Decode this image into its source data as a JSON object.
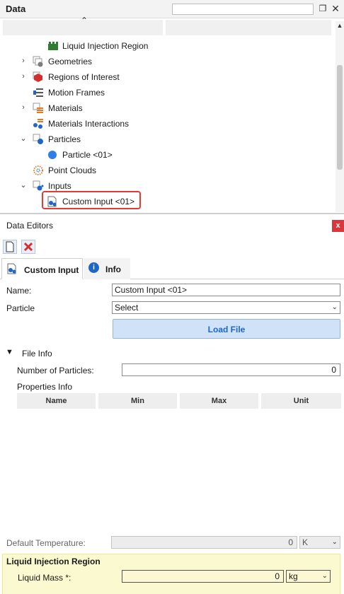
{
  "data_panel": {
    "title": "Data",
    "search_value": "",
    "tree": [
      {
        "label": "Liquid Injection Region",
        "icon": "liquid-injection-region-icon",
        "expander": "",
        "level": 2
      },
      {
        "label": "Geometries",
        "icon": "geometries-folder-icon",
        "expander": "›",
        "level": 1
      },
      {
        "label": "Regions of Interest",
        "icon": "regions-of-interest-folder-icon",
        "expander": "›",
        "level": 1
      },
      {
        "label": "Motion Frames",
        "icon": "motion-frames-icon",
        "expander": "",
        "level": 1
      },
      {
        "label": "Materials",
        "icon": "materials-folder-icon",
        "expander": "›",
        "level": 1
      },
      {
        "label": "Materials Interactions",
        "icon": "materials-interactions-icon",
        "expander": "",
        "level": 1
      },
      {
        "label": "Particles",
        "icon": "particles-folder-icon",
        "expander": "⌄",
        "level": 1
      },
      {
        "label": "Particle <01>",
        "icon": "particle-dot-icon",
        "expander": "",
        "level": 2
      },
      {
        "label": "Point Clouds",
        "icon": "point-clouds-icon",
        "expander": "",
        "level": 1
      },
      {
        "label": "Inputs",
        "icon": "inputs-folder-icon",
        "expander": "⌄",
        "level": 1
      },
      {
        "label": "Custom Input <01>",
        "icon": "custom-input-icon",
        "expander": "",
        "level": 2
      }
    ]
  },
  "editors": {
    "title": "Data Editors",
    "close_label": "x",
    "tabs": [
      {
        "label": "Custom Input",
        "active": true
      },
      {
        "label": "Info",
        "active": false
      }
    ],
    "name_label": "Name:",
    "name_value": "Custom Input <01>",
    "particle_label": "Particle",
    "particle_value": "Select",
    "load_button": "Load File",
    "file_info_label": "File Info",
    "num_particles_label": "Number of Particles:",
    "num_particles_value": "0",
    "properties_info_label": "Properties Info",
    "prop_columns": [
      "Name",
      "Min",
      "Max",
      "Unit"
    ],
    "default_temp_label": "Default Temperature:",
    "default_temp_value": "0",
    "default_temp_unit": "K",
    "liquid_section_title": "Liquid Injection Region",
    "liquid_mass_label": "Liquid Mass *:",
    "liquid_mass_value": "0",
    "liquid_mass_unit": "kg"
  },
  "colors": {
    "highlight_red": "#e53935",
    "section_yellow": "#fbf9cf",
    "load_button_blue": "#cfe2f8",
    "close_red": "#d9363e"
  }
}
